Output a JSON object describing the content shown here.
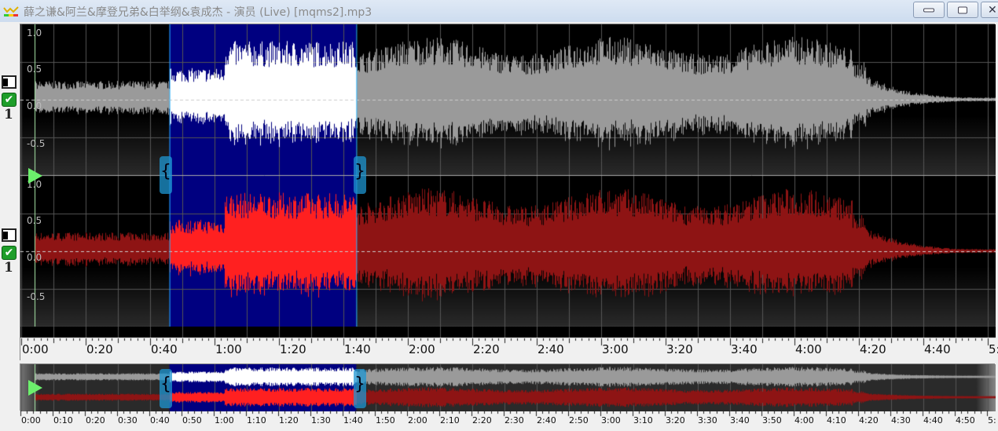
{
  "window": {
    "title": "薛之谦&阿兰&摩登兄弟&白举纲&袁成杰 - 演员 (Live) [mqms2].mp3",
    "minimize_icon": "minimize-icon",
    "maximize_icon": "restore-icon",
    "close_icon": "close-icon"
  },
  "channels": [
    {
      "number": "1",
      "enabled": true,
      "y_labels": [
        "1.0",
        "0.5",
        "0.0",
        "-0.5"
      ],
      "color": "#9a9a9a",
      "selected_color": "#ffffff"
    },
    {
      "number": "1",
      "enabled": true,
      "y_labels": [
        "1.0",
        "0.5",
        "0.0",
        "-0.5"
      ],
      "color": "#8e1414",
      "selected_color": "#ff2020"
    }
  ],
  "selection": {
    "start": "0:46",
    "end": "1:44",
    "color": "#000080"
  },
  "duration": "5:00",
  "ruler_labels": [
    "0:00",
    "0:20",
    "0:40",
    "1:00",
    "1:20",
    "1:40",
    "2:00",
    "2:20",
    "2:40",
    "3:00",
    "3:20",
    "3:40",
    "4:00",
    "4:20",
    "4:40",
    "5:"
  ],
  "overview_ruler_labels": [
    "0:00",
    "0:10",
    "0:20",
    "0:30",
    "0:40",
    "0:50",
    "1:00",
    "1:10",
    "1:20",
    "1:30",
    "1:40",
    "1:50",
    "2:00",
    "2:10",
    "2:20",
    "2:30",
    "2:40",
    "2:50",
    "3:00",
    "3:10",
    "3:20",
    "3:30",
    "3:40",
    "3:50",
    "4:00",
    "4:10",
    "4:20",
    "4:30",
    "4:40",
    "4:50",
    "5:"
  ]
}
